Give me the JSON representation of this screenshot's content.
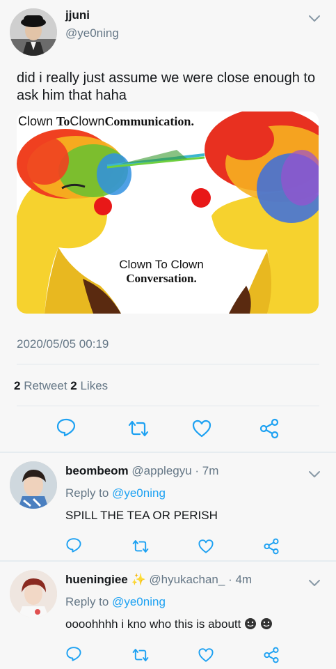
{
  "tweet": {
    "author_name": "jjuni",
    "author_handle": "@ye0ning",
    "text": "did i really just assume we were close enough to ask him that haha",
    "timestamp": "2020/05/05 00:19",
    "retweet_count": "2",
    "retweet_label": " Retweet ",
    "like_count": "2",
    "like_label": " Likes",
    "media": {
      "top_caption_a": "Clown",
      "top_caption_b": "To",
      "top_caption_c": "Clown",
      "top_caption_d": "Communication.",
      "bottom_caption_line1": "Clown To Clown",
      "bottom_caption_line2": "Conversation."
    }
  },
  "replies": [
    {
      "name": "beombeom",
      "handle": "@applegyu",
      "time": "· 7m",
      "reply_to_label": "Reply to ",
      "reply_to_handle": "@ye0ning",
      "text": "SPILL THE TEA OR PERISH"
    },
    {
      "name": "hueningiee",
      "handle": "@hyukachan_",
      "time": "· 4m",
      "reply_to_label": "Reply to ",
      "reply_to_handle": "@ye0ning",
      "text": "oooohhhh i kno who this is aboutt"
    }
  ],
  "colors": {
    "accent": "#1da1f2",
    "secondary_text": "#657786",
    "icon_gray": "#657786",
    "divider": "#e1e8ed"
  },
  "icons": [
    "chevron-down-icon",
    "reply-icon",
    "retweet-icon",
    "like-icon",
    "share-icon",
    "emoji-icon"
  ]
}
